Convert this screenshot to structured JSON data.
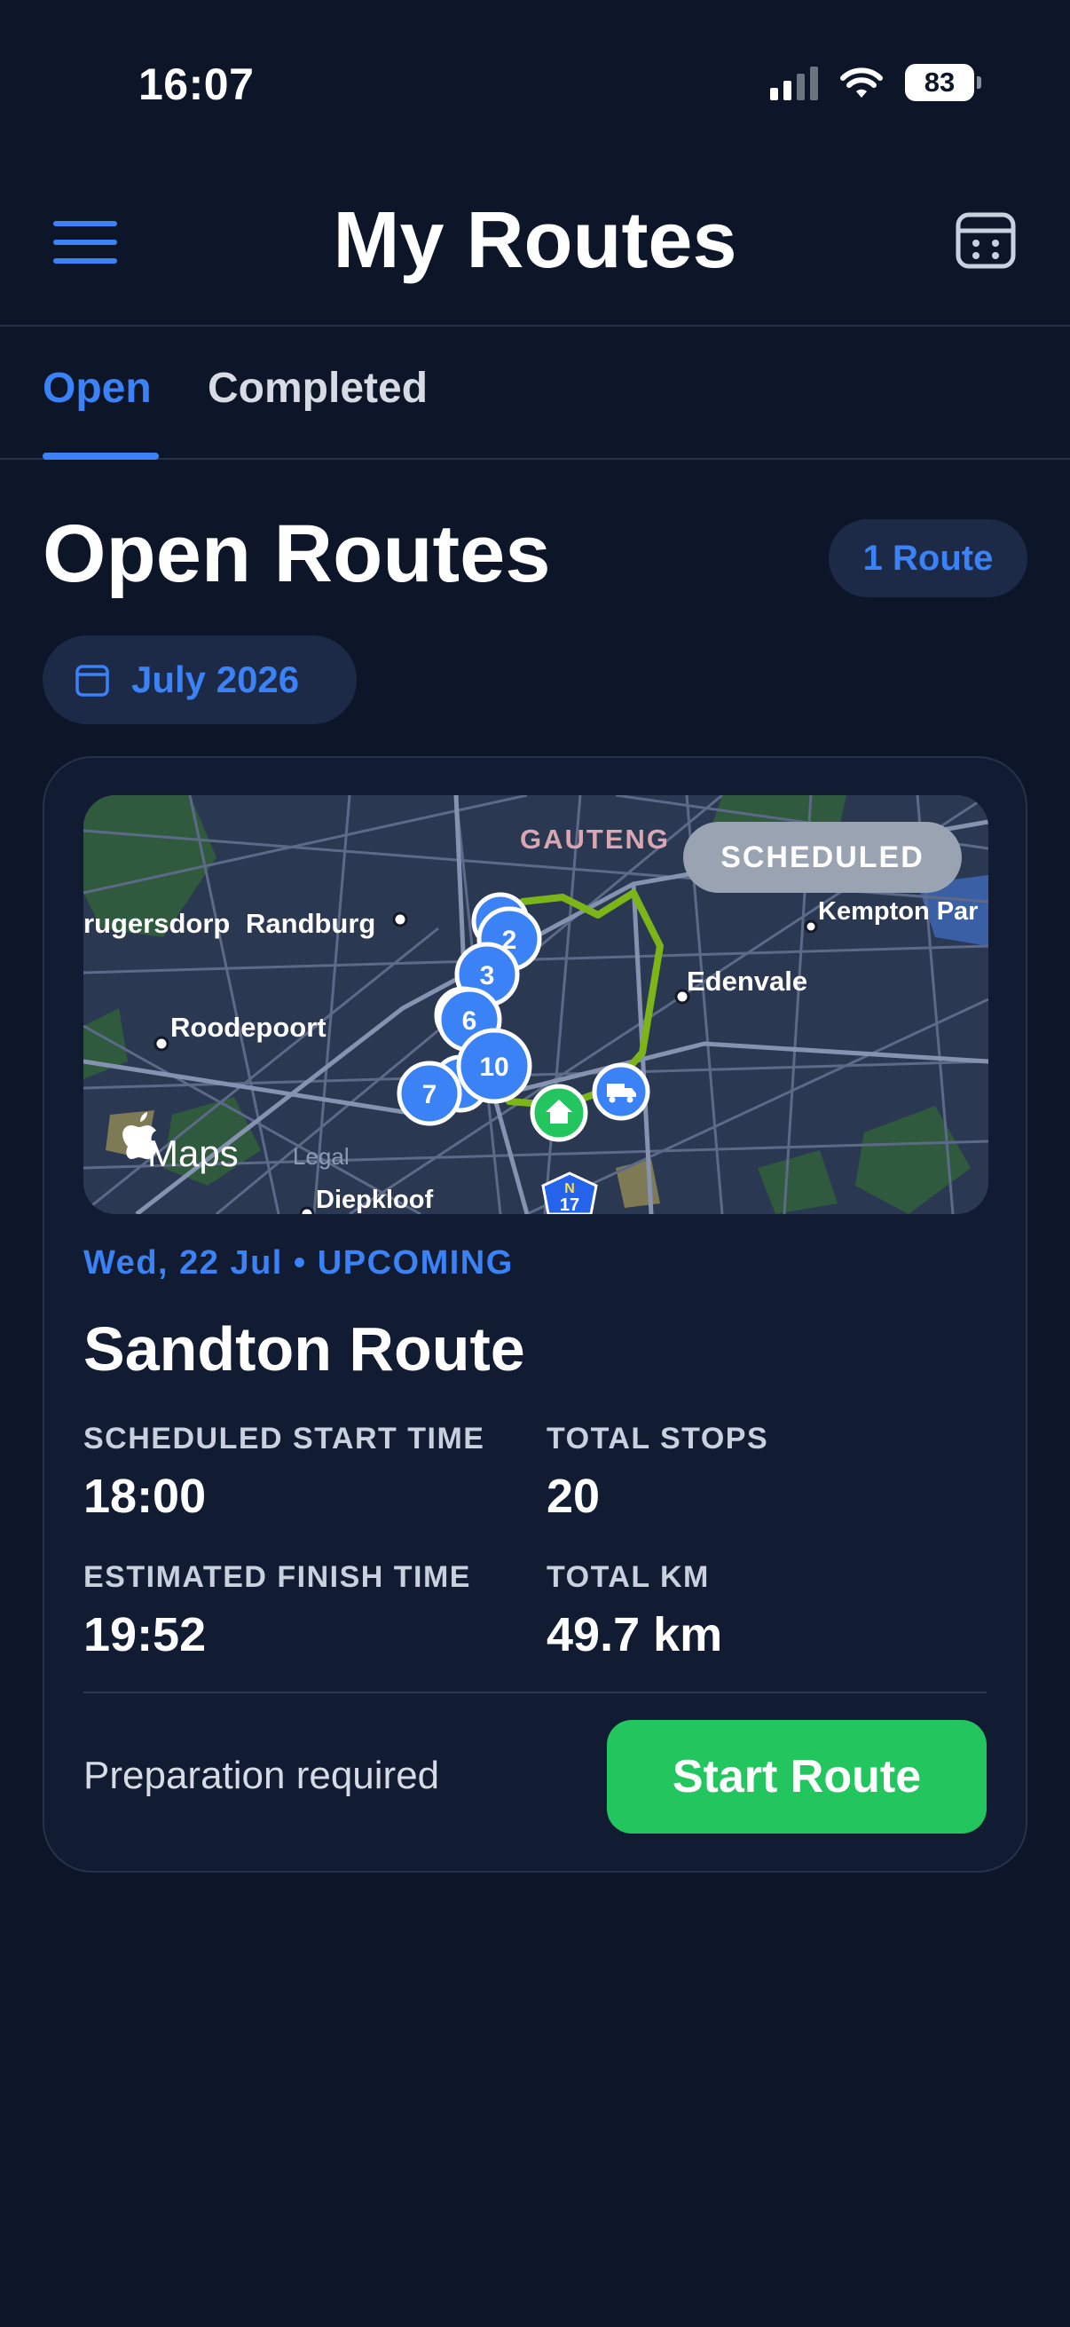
{
  "status_bar": {
    "time": "16:07",
    "battery": "83"
  },
  "header": {
    "title": "My Routes"
  },
  "tabs": [
    {
      "label": "Open",
      "active": true
    },
    {
      "label": "Completed",
      "active": false
    }
  ],
  "section": {
    "title": "Open Routes",
    "count_badge": "1 Route",
    "month": "July 2026"
  },
  "route_card": {
    "map": {
      "status": "SCHEDULED",
      "attribution": "Maps",
      "legal": "Legal",
      "places": [
        "GAUTENG",
        "rugersdorp",
        "Randburg",
        "Kempton Par",
        "Edenvale",
        "Roodepoort",
        "Diepkloof"
      ],
      "stop_numbers": [
        "2",
        "3",
        "6",
        "10",
        "7"
      ],
      "highway_shield": "17",
      "highway_letter": "N"
    },
    "date_line": "Wed, 22 Jul • UPCOMING",
    "name": "Sandton Route",
    "stats": [
      {
        "label": "SCHEDULED START TIME",
        "value": "18:00"
      },
      {
        "label": "TOTAL STOPS",
        "value": "20"
      },
      {
        "label": "ESTIMATED FINISH TIME",
        "value": "19:52"
      },
      {
        "label": "TOTAL KM",
        "value": "49.7 km"
      }
    ],
    "prep_text": "Preparation required",
    "start_button": "Start Route"
  },
  "colors": {
    "accent": "#3b82f6",
    "success": "#22c55e",
    "background": "#0d1629",
    "card": "#111c33",
    "route": "#7cb518"
  }
}
